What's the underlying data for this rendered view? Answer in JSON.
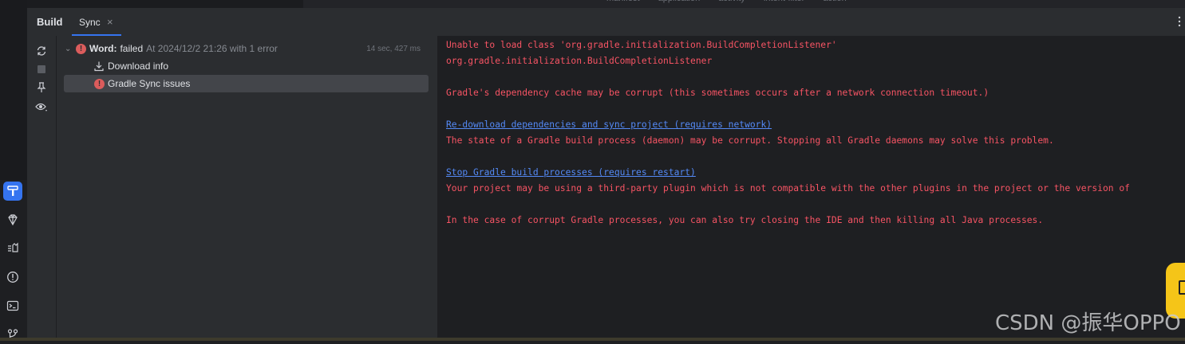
{
  "top_breadcrumbs": [
    "manifest",
    "application",
    "activity",
    "intent-filter",
    "action"
  ],
  "build_panel": {
    "title": "Build",
    "tab": {
      "label": "Sync",
      "close": "×"
    }
  },
  "tree": {
    "root": {
      "name": "Word:",
      "status": "failed",
      "detail": "At 2024/12/2 21:26 with 1 error",
      "time": "14 sec, 427 ms"
    },
    "children": [
      {
        "label": "Download info",
        "icon": "download-icon"
      },
      {
        "label": "Gradle Sync issues",
        "icon": "error-icon"
      }
    ]
  },
  "console": {
    "line1": "Unable to load class 'org.gradle.initialization.BuildCompletionListener'",
    "line2": "org.gradle.initialization.BuildCompletionListener",
    "line3": "Gradle's dependency cache may be corrupt (this sometimes occurs after a network connection timeout.)",
    "link1": "Re-download dependencies and sync project (requires network)",
    "line4": "The state of a Gradle build process (daemon) may be corrupt. Stopping all Gradle daemons may solve this problem.",
    "link2": "Stop Gradle build processes (requires restart)",
    "line5": "Your project may be using a third-party plugin which is not compatible with the other plugins in the project or the version of",
    "line6": "In the case of corrupt Gradle processes, you can also try closing the IDE and then killing all Java processes."
  },
  "watermark": "CSDN @振华OPPO",
  "colors": {
    "accent": "#3574f0",
    "error_text": "#f75464",
    "link": "#548af7"
  }
}
